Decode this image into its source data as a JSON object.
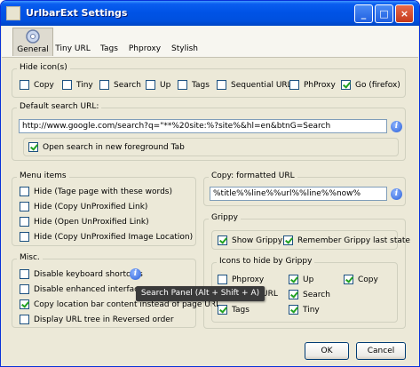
{
  "window": {
    "title": "UrlbarExt Settings",
    "minimize": "_",
    "maximize": "□",
    "close": "×"
  },
  "tabs": [
    {
      "label": "General"
    },
    {
      "label": "Tiny URL"
    },
    {
      "label": "Tags"
    },
    {
      "label": "Phproxy"
    },
    {
      "label": "Stylish"
    }
  ],
  "hide_icons": {
    "legend": "Hide icon(s)",
    "items": [
      {
        "label": "Copy",
        "checked": false
      },
      {
        "label": "Tiny",
        "checked": false
      },
      {
        "label": "Search",
        "checked": false
      },
      {
        "label": "Up",
        "checked": false
      },
      {
        "label": "Tags",
        "checked": false
      },
      {
        "label": "Sequential URL",
        "checked": false
      },
      {
        "label": "PhProxy",
        "checked": false
      },
      {
        "label": "Go (firefox)",
        "checked": true
      }
    ]
  },
  "search_url": {
    "legend": "Default search URL:",
    "value": "http://www.google.com/search?q=\"**%20site:%?site%&hl=en&btnG=Search",
    "foreground_label": "Open search in new foreground Tab",
    "foreground_checked": true
  },
  "menu_items": {
    "legend": "Menu items",
    "items": [
      {
        "label": "Hide (Tage page with these words)",
        "checked": false
      },
      {
        "label": "Hide (Copy UnProxified Link)",
        "checked": false
      },
      {
        "label": "Hide (Open UnProxified Link)",
        "checked": false
      },
      {
        "label": "Hide (Copy UnProxified Image Location)",
        "checked": false
      }
    ]
  },
  "copy_formatted": {
    "legend": "Copy: formatted URL",
    "value": "%title%%line%%url%%line%%now%"
  },
  "grippy": {
    "legend": "Grippy",
    "show_label": "Show Grippy",
    "show_checked": true,
    "remember_label": "Remember Grippy last state",
    "remember_checked": true
  },
  "icons_to_hide": {
    "legend": "Icons to hide by Grippy",
    "items": [
      {
        "label": "Phproxy",
        "checked": false
      },
      {
        "label": "Up",
        "checked": true
      },
      {
        "label": "Copy",
        "checked": true
      },
      {
        "label": "URL",
        "checked": false
      },
      {
        "label": "Search",
        "checked": true
      },
      {
        "label": "Tags",
        "checked": true
      },
      {
        "label": "Tiny",
        "checked": true
      }
    ]
  },
  "misc": {
    "legend": "Misc.",
    "items": [
      {
        "label": "Disable keyboard shortcuts",
        "checked": false
      },
      {
        "label": "Disable enhanced interface",
        "checked": false
      },
      {
        "label": "Copy location bar content instead of page URL",
        "checked": true
      },
      {
        "label": "Display URL tree in Reversed order",
        "checked": false
      }
    ]
  },
  "tooltip": "Search Panel (Alt + Shift + A)",
  "buttons": {
    "ok": "OK",
    "cancel": "Cancel"
  }
}
